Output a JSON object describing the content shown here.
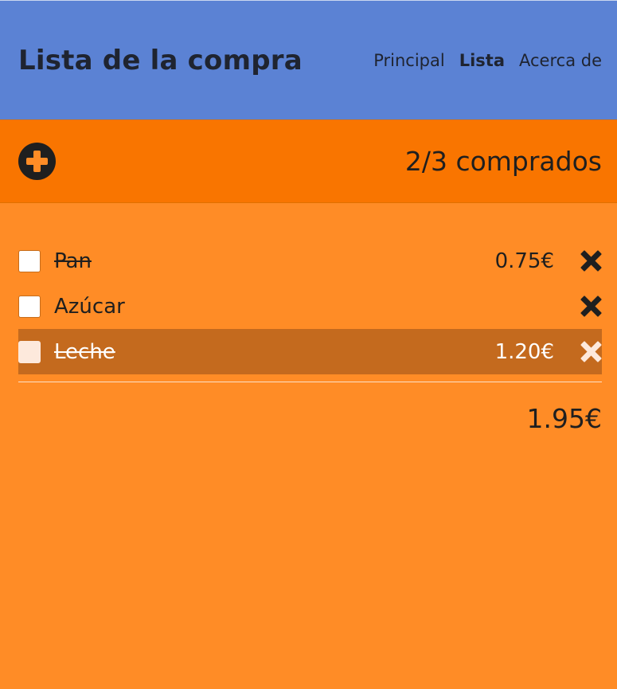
{
  "header": {
    "title": "Lista de la compra",
    "nav": [
      {
        "label": "Principal",
        "active": false
      },
      {
        "label": "Lista",
        "active": true
      },
      {
        "label": "Acerca de",
        "active": false
      }
    ]
  },
  "toolbar": {
    "add_icon": "plus-circle-icon",
    "bought_count": "2/3 comprados"
  },
  "items": [
    {
      "name": "Pan",
      "price": "0.75€",
      "bought": true,
      "highlight": false
    },
    {
      "name": "Azúcar",
      "price": "",
      "bought": false,
      "highlight": false
    },
    {
      "name": "Leche",
      "price": "1.20€",
      "bought": true,
      "highlight": true
    }
  ],
  "total": "1.95€",
  "colors": {
    "header_bg": "#5b82d4",
    "toolbar_bg": "#f97500",
    "page_bg": "#ff8c26",
    "highlight_row": "#c46a1e"
  }
}
